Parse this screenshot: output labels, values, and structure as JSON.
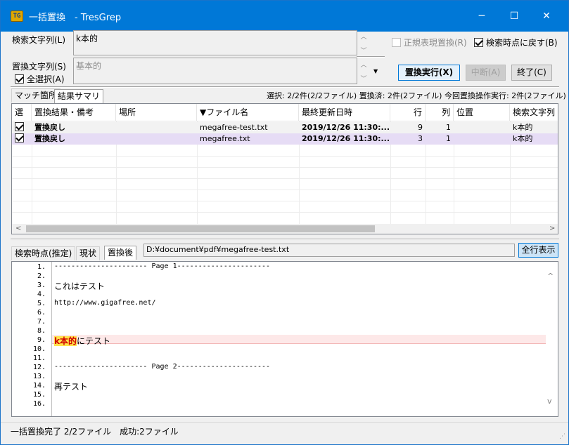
{
  "window": {
    "title": "一括置換　- TresGrep",
    "app_icon_text": "TG",
    "minimize_glyph": "─",
    "maximize_glyph": "☐",
    "close_glyph": "✕"
  },
  "search": {
    "label": "検索文字列(L)",
    "value": "k本的",
    "replace_label": "置換文字列(S)",
    "replace_value": "基本的",
    "select_all_label": "全選択(A)",
    "select_all_checked": true
  },
  "options": {
    "regex_label": "正規表現置換(R)",
    "regex_checked": false,
    "regex_enabled": false,
    "revert_label": "検索時点に戻す(B)",
    "revert_checked": true
  },
  "buttons": {
    "execute": "置換実行(X)",
    "interrupt": "中断(A)",
    "close": "終了(C)",
    "show_all_lines": "全行表示"
  },
  "results_tabs": [
    "マッチ箇所",
    "結果サマリ"
  ],
  "summary": "選択: 2/2件(2/2ファイル)  置換済: 2件(2ファイル)  今回置換操作実行: 2件(2ファイル)",
  "table": {
    "columns": [
      "選",
      "置換結果・備考",
      "場所",
      "▼ファイル名",
      "最終更新日時",
      "行",
      "列",
      "位置",
      "検索文字列"
    ],
    "rows": [
      {
        "checked": true,
        "result": "置換戻し",
        "location": "",
        "file": "megafree-test.txt",
        "modified": "2019/12/26 11:30:...",
        "line": "9",
        "col": "1",
        "pos": "",
        "search": "k本的",
        "selected": false
      },
      {
        "checked": true,
        "result": "置換戻し",
        "location": "",
        "file": "megafree.txt",
        "modified": "2019/12/26 11:30:...",
        "line": "3",
        "col": "1",
        "pos": "",
        "search": "k本的",
        "selected": true
      }
    ],
    "scroll_left": "<",
    "scroll_right": ">"
  },
  "view_tabs": [
    "検索時点(推定)",
    "現状",
    "置換後"
  ],
  "active_view_tab": 2,
  "file_path": "D:¥document¥pdf¥megafree-test.txt",
  "editor": {
    "lines": [
      {
        "n": "1.",
        "text": "---------------------- Page 1----------------------",
        "mono": true
      },
      {
        "n": "2.",
        "text": ""
      },
      {
        "n": "3.",
        "text": "これはテスト"
      },
      {
        "n": "4.",
        "text": ""
      },
      {
        "n": "5.",
        "text": "http://www.gigafree.net/",
        "mono": true
      },
      {
        "n": "6.",
        "text": ""
      },
      {
        "n": "7.",
        "text": ""
      },
      {
        "n": "8.",
        "text": ""
      },
      {
        "n": "9.",
        "text": "にテスト",
        "highlight": "k本的"
      },
      {
        "n": "10.",
        "text": ""
      },
      {
        "n": "11.",
        "text": ""
      },
      {
        "n": "12.",
        "text": "---------------------- Page 2----------------------",
        "mono": true
      },
      {
        "n": "13.",
        "text": ""
      },
      {
        "n": "14.",
        "text": "再テスト"
      },
      {
        "n": "15.",
        "text": ""
      },
      {
        "n": "16.",
        "text": ""
      }
    ],
    "scroll_up": "^",
    "scroll_down": "v"
  },
  "status": {
    "text": "一括置換完了 2/2ファイル　成功:2ファイル",
    "grip": "⋰"
  }
}
